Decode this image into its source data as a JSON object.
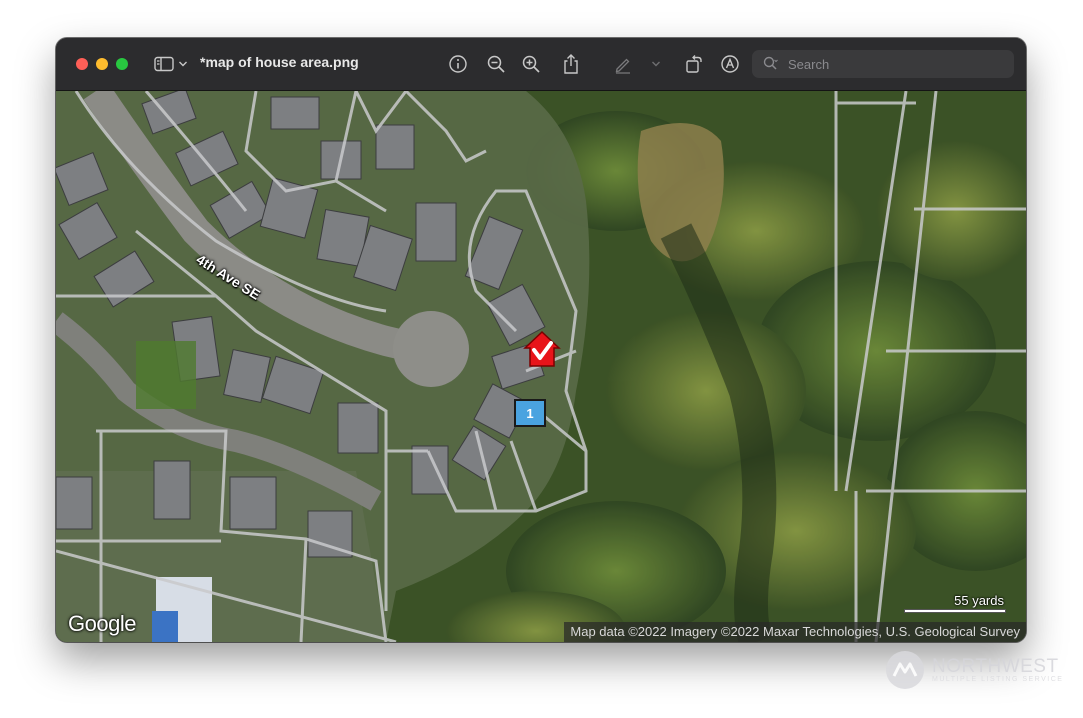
{
  "window": {
    "title": "*map of house area.png",
    "search_placeholder": "Search"
  },
  "toolbar": {
    "icons": [
      "sidebar-icon",
      "chevron-down-icon",
      "info-icon",
      "zoom-out-icon",
      "zoom-in-icon",
      "share-icon",
      "markup-icon",
      "chevron-down-icon",
      "rotate-icon",
      "annotate-icon",
      "search-icon"
    ]
  },
  "map": {
    "street_label": "4th Ave SE",
    "provider": "Google",
    "attribution": "Map data ©2022 Imagery ©2022 Maxar Technologies, U.S. Geological Survey",
    "scale_label": "55 yards",
    "marker_number": "1",
    "marker_color": "#4aa3e0",
    "home_marker_color": "#e8141a"
  },
  "watermark": {
    "name": "NORTHWEST",
    "subtitle": "MULTIPLE LISTING SERVICE"
  }
}
